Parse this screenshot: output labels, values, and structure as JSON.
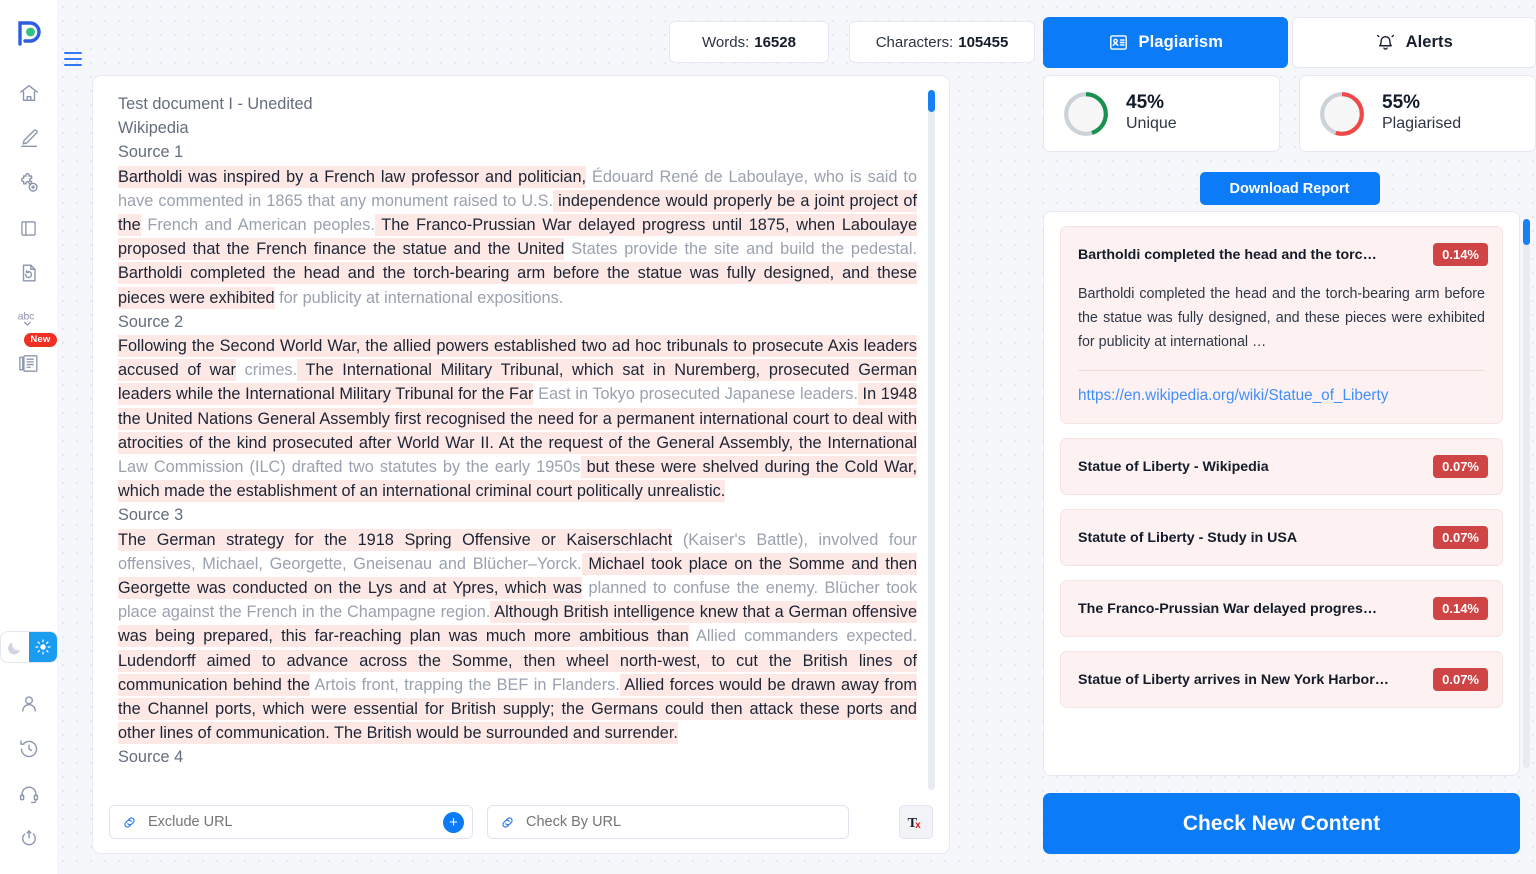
{
  "app": {
    "logo_name": "plagiarism-checker-logo",
    "menu_label": "Menu"
  },
  "sidebar": {
    "items": [
      {
        "icon": "home-icon",
        "label": "Home"
      },
      {
        "icon": "edit-pencil-icon",
        "label": "Edit"
      },
      {
        "icon": "puzzle-add-icon",
        "label": "Add Integration"
      },
      {
        "icon": "book-icon",
        "label": "Documents"
      },
      {
        "icon": "document-history-icon",
        "label": "Document History"
      },
      {
        "icon": "abc-spellcheck-icon",
        "label": "Grammar Check"
      },
      {
        "icon": "news-article-icon",
        "label": "Articles",
        "badge": "New"
      }
    ],
    "bottom_items": [
      {
        "icon": "user-account-icon",
        "label": "Account"
      },
      {
        "icon": "clock-history-icon",
        "label": "History"
      },
      {
        "icon": "headset-support-icon",
        "label": "Support"
      },
      {
        "icon": "power-logout-icon",
        "label": "Logout"
      }
    ],
    "theme_toggle": {
      "dark_icon": "moon-icon",
      "light_icon": "sun-icon",
      "active": "light"
    }
  },
  "topbar": {
    "words_label": "Words:",
    "words_value": "16528",
    "characters_label": "Characters:",
    "characters_value": "105455"
  },
  "tabs": [
    {
      "id": "plagiarism",
      "label": "Plagiarism",
      "icon": "report-card-icon",
      "active": true
    },
    {
      "id": "alerts",
      "label": "Alerts",
      "icon": "bell-icon",
      "active": false
    }
  ],
  "editor": {
    "doc_title": "Test document I - Unedited",
    "doc_subtitle": "Wikipedia",
    "sources": [
      {
        "label": "Source 1",
        "runs": [
          {
            "t": "Bartholdi was inspired by a French law professor and politician,",
            "hl": true
          },
          {
            "t": " Édouard René de Laboulaye, who is said to have commented in 1865 that any monument raised to U.S.",
            "hl": false
          },
          {
            "t": " independence would properly be a joint project of the",
            "hl": true
          },
          {
            "t": " French and American peoples.",
            "hl": false
          },
          {
            "t": " The Franco-Prussian War delayed progress until 1875, when Laboulaye proposed that the French finance the statue and the United",
            "hl": true
          },
          {
            "t": " States provide the site and build the pedestal.",
            "hl": false
          },
          {
            "t": " Bartholdi completed the head and the torch-bearing arm before",
            "hl": true
          },
          {
            "t": " the statue was fully designed, and these pieces were exhibited",
            "hl": true
          },
          {
            "t": " for publicity at international expositions.",
            "hl": false
          }
        ]
      },
      {
        "label": "Source 2",
        "runs": [
          {
            "t": "Following the Second World War, the allied powers established two",
            "hl": true
          },
          {
            "t": " ad hoc tribunals to prosecute Axis leaders accused of war",
            "hl": true
          },
          {
            "t": " crimes.",
            "hl": false
          },
          {
            "t": " The International Military Tribunal, which sat in Nuremberg, prosecuted German leaders while the International Military Tribunal for the Far",
            "hl": true
          },
          {
            "t": " East in Tokyo prosecuted Japanese leaders.",
            "hl": false
          },
          {
            "t": " In 1948 the United Nations General Assembly first recognised",
            "hl": true
          },
          {
            "t": " the need for a permanent international court to deal with",
            "hl": true
          },
          {
            "t": " atrocities of the kind prosecuted after World War II.",
            "hl": true
          },
          {
            "t": " At the request of the General Assembly, the International",
            "hl": true
          },
          {
            "t": " Law Commission (ILC) drafted two statutes by the early 1950s",
            "hl": false
          },
          {
            "t": " but these were shelved during the Cold War, which made",
            "hl": true
          },
          {
            "t": " the establishment of an international criminal court politically unrealistic.",
            "hl": true
          }
        ]
      },
      {
        "label": "Source 3",
        "runs": [
          {
            "t": "The German strategy for the 1918 Spring Offensive or Kaiserschlacht",
            "hl": true
          },
          {
            "t": " (Kaiser's Battle), involved four offensives, Michael, Georgette, Gneisenau and Blücher–Yorck.",
            "hl": false
          },
          {
            "t": " Michael took place on the Somme and then Georgette",
            "hl": true
          },
          {
            "t": " was conducted on the Lys and at Ypres, which was",
            "hl": true
          },
          {
            "t": " planned to confuse the enemy. Blücher took place against the French in the Champagne region.",
            "hl": false
          },
          {
            "t": " Although British intelligence knew that a German offensive was",
            "hl": true
          },
          {
            "t": " being prepared, this far-reaching plan was much more ambitious than",
            "hl": true
          },
          {
            "t": " Allied commanders expected.",
            "hl": false
          },
          {
            "t": " Ludendorff aimed to advance across the Somme, then wheel",
            "hl": true
          },
          {
            "t": " north-west, to cut the British lines of communication behind the",
            "hl": true
          },
          {
            "t": " Artois front, trapping the BEF in Flanders.",
            "hl": false
          },
          {
            "t": " Allied forces would be drawn away from the Channel",
            "hl": true
          },
          {
            "t": " ports, which were essential for British supply; the Germans could",
            "hl": true
          },
          {
            "t": " then attack these ports and other lines of communication.",
            "hl": true
          },
          {
            "t": " The British would be surrounded and surrender.",
            "hl": true
          }
        ]
      },
      {
        "label": "Source 4",
        "runs": []
      }
    ]
  },
  "editor_footer": {
    "exclude_url_placeholder": "Exclude URL",
    "exclude_url_value": "",
    "check_url_placeholder": "Check By URL",
    "check_url_value": "",
    "add_button_label": "+",
    "link_icon": "link-chain-icon",
    "clear_format_icon": "clear-formatting-tx-icon"
  },
  "scores": {
    "unique": {
      "percent": "45%",
      "label": "Unique",
      "value": 45,
      "color": "#17914f"
    },
    "plagiarised": {
      "percent": "55%",
      "label": "Plagiarised",
      "value": 55,
      "color": "#ef4a4a"
    },
    "track_color": "#cdd1d8"
  },
  "download_report_label": "Download Report",
  "results": [
    {
      "title": "Bartholdi completed the head and the torc…",
      "percent": "0.14%",
      "snippet": "Bartholdi completed the head and the torch-bearing arm before the statue was fully designed, and these pieces were exhibited for publicity at international …",
      "url": "https://en.wikipedia.org/wiki/Statue_of_Liberty",
      "expanded": true
    },
    {
      "title": "Statue of Liberty - Wikipedia",
      "percent": "0.07%",
      "expanded": false
    },
    {
      "title": "Statute of Liberty - Study in USA",
      "percent": "0.07%",
      "expanded": false
    },
    {
      "title": "The Franco-Prussian War delayed progres…",
      "percent": "0.14%",
      "expanded": false
    },
    {
      "title": "Statue of Liberty arrives in New York Harbor…",
      "percent": "0.07%",
      "expanded": false
    }
  ],
  "check_new_content_label": "Check New Content",
  "colors": {
    "primary_blue": "#0b7bf7",
    "highlight_pink": "#fde8e6",
    "badge_red": "#cf4444",
    "green": "#17914f"
  }
}
